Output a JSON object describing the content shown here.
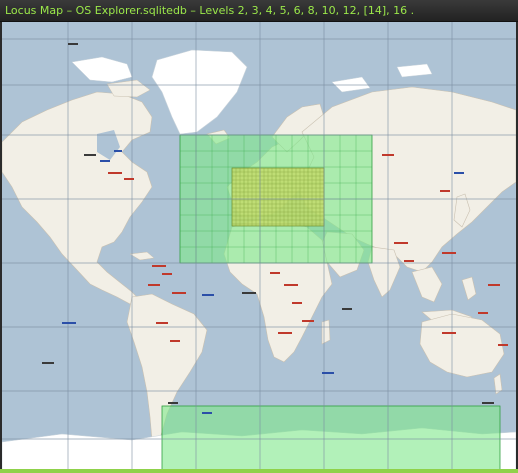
{
  "window": {
    "title": "Locus Map – OS Explorer.sqlitedb – Levels 2, 3, 4, 5, 6, 8, 10, 12, [14], 16 ."
  },
  "map": {
    "projection": "web-mercator",
    "colors": {
      "ocean": "#aec3d5",
      "land": "#f2efe6",
      "ice": "#ffffff",
      "grid_line": "#7a8da0",
      "coverage_outer": "#7fe88a",
      "coverage_inner": "#c6d862",
      "coverage_stroke": "#2f9f3f",
      "country_border": "#b39ac0",
      "label_red": "#c0392b",
      "label_blue": "#2b4fa8",
      "label_dark": "#3a3a3a",
      "accent_title": "#9be84a"
    },
    "coverage": [
      {
        "name": "level-region-europe-africa",
        "level": "outer"
      },
      {
        "name": "level-region-central-europe",
        "level": "inner"
      },
      {
        "name": "level-region-antarctica",
        "level": "outer"
      }
    ]
  }
}
